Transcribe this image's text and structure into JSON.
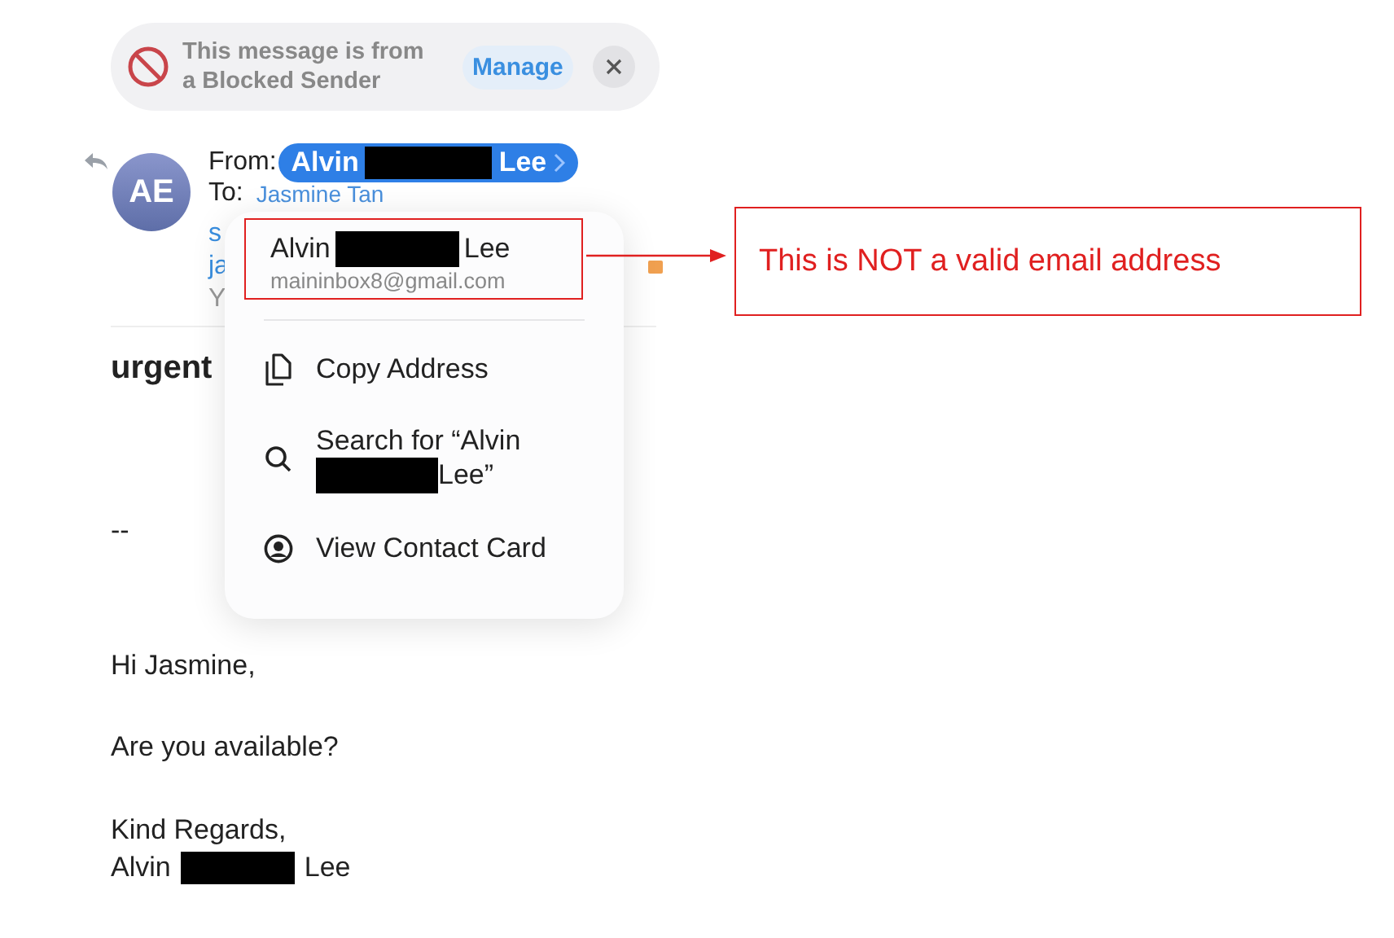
{
  "banner": {
    "message": "This message is from a Blocked Sender",
    "action": "Manage"
  },
  "header": {
    "avatar_initials": "AE",
    "from_label": "From:",
    "from_first": "Alvin",
    "from_last": "Lee",
    "to_label": "To:",
    "to_recipient": "Jasmine Tan",
    "fragments": [
      "s",
      "ja",
      "Y"
    ]
  },
  "subject": "urgent",
  "body": [
    "--",
    "Hi Jasmine,",
    "Are you available?",
    "Kind Regards,"
  ],
  "signature": {
    "first": "Alvin",
    "last": "Lee"
  },
  "menu": {
    "contact": {
      "first": "Alvin",
      "last": "Lee",
      "email": "maininbox8@gmail.com"
    },
    "items": [
      {
        "kind": "copy",
        "label": "Copy Address"
      },
      {
        "kind": "search",
        "label": "Search for “Alvin",
        "label_end": "Lee”"
      },
      {
        "kind": "contact",
        "label": "View Contact Card"
      }
    ]
  },
  "annotation": {
    "text": "This is NOT a valid email address"
  }
}
